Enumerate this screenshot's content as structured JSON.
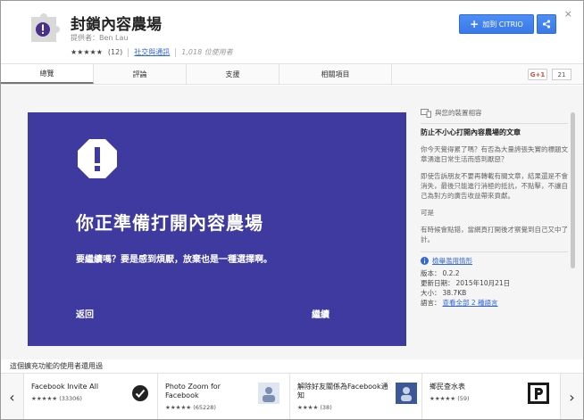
{
  "header": {
    "title": "封鎖內容農場",
    "provider": "提供者：Ben Lau",
    "stars": "★★★★★",
    "rating_count": "(12)",
    "category_link": "社交與通訊",
    "users": "1,018 位使用者",
    "add_button": "加到 CITRIO",
    "close_label": "×"
  },
  "tabs": [
    {
      "label": "總覽"
    },
    {
      "label": "評論"
    },
    {
      "label": "支援"
    },
    {
      "label": "相關項目"
    }
  ],
  "gplus": {
    "label": "G+1",
    "count": "21"
  },
  "screenshot": {
    "headline": "你正準備打開內容農場",
    "body": "要繼續嗎？要是感到煩厭，放棄也是一種選擇啊。",
    "back": "返回",
    "continue": "繼續",
    "background_color": "#3f3aa0"
  },
  "side": {
    "compat": "與您的裝置相容",
    "desc_title": "防止不小心打開內容農場的文章",
    "paragraphs": [
      "你今天覺得累了嗎？有否為大量誇張失實的標題文章湧進日常生活而感到厭惡？",
      "即使告訴朋友不要再轉載有關文章，結果還是不會消失，最後只能進行消極的抵抗，不點擊，不讓自己為對方的廣告收益帶來貢獻。",
      "可是",
      "有時候會點錯，當網頁打開後才察覺到自己又中了計。"
    ],
    "report_link": "檢舉濫用情形",
    "version_label": "版本：",
    "version": "0.2.2",
    "updated_label": "更新日期：",
    "updated": "2015年10月21日",
    "size_label": "大小：",
    "size": "38.7KB",
    "language_label": "語言：",
    "language_link": "查看全部 2 種語言"
  },
  "related": {
    "title": "這個擴充功能的使用者還用過",
    "items": [
      {
        "name": "Facebook Invite All",
        "stars": "★★★★★",
        "count": "(33306)",
        "icon": "checkmark-icon"
      },
      {
        "name": "Photo Zoom for Facebook",
        "stars": "★★★★★",
        "count": "(65228)",
        "icon": "photo-zoom-icon"
      },
      {
        "name": "解除好友關係為Facebook通知",
        "stars": "★★★★",
        "count": "(38)",
        "icon": "friend-notify-icon"
      },
      {
        "name": "鄉民查水表",
        "stars": "★★★★★",
        "count": "(59)",
        "icon": "parking-p-icon"
      }
    ]
  },
  "colors": {
    "accent": "#4d8ef5",
    "screenshot_bg": "#3f3aa0",
    "link": "#3367d6"
  }
}
